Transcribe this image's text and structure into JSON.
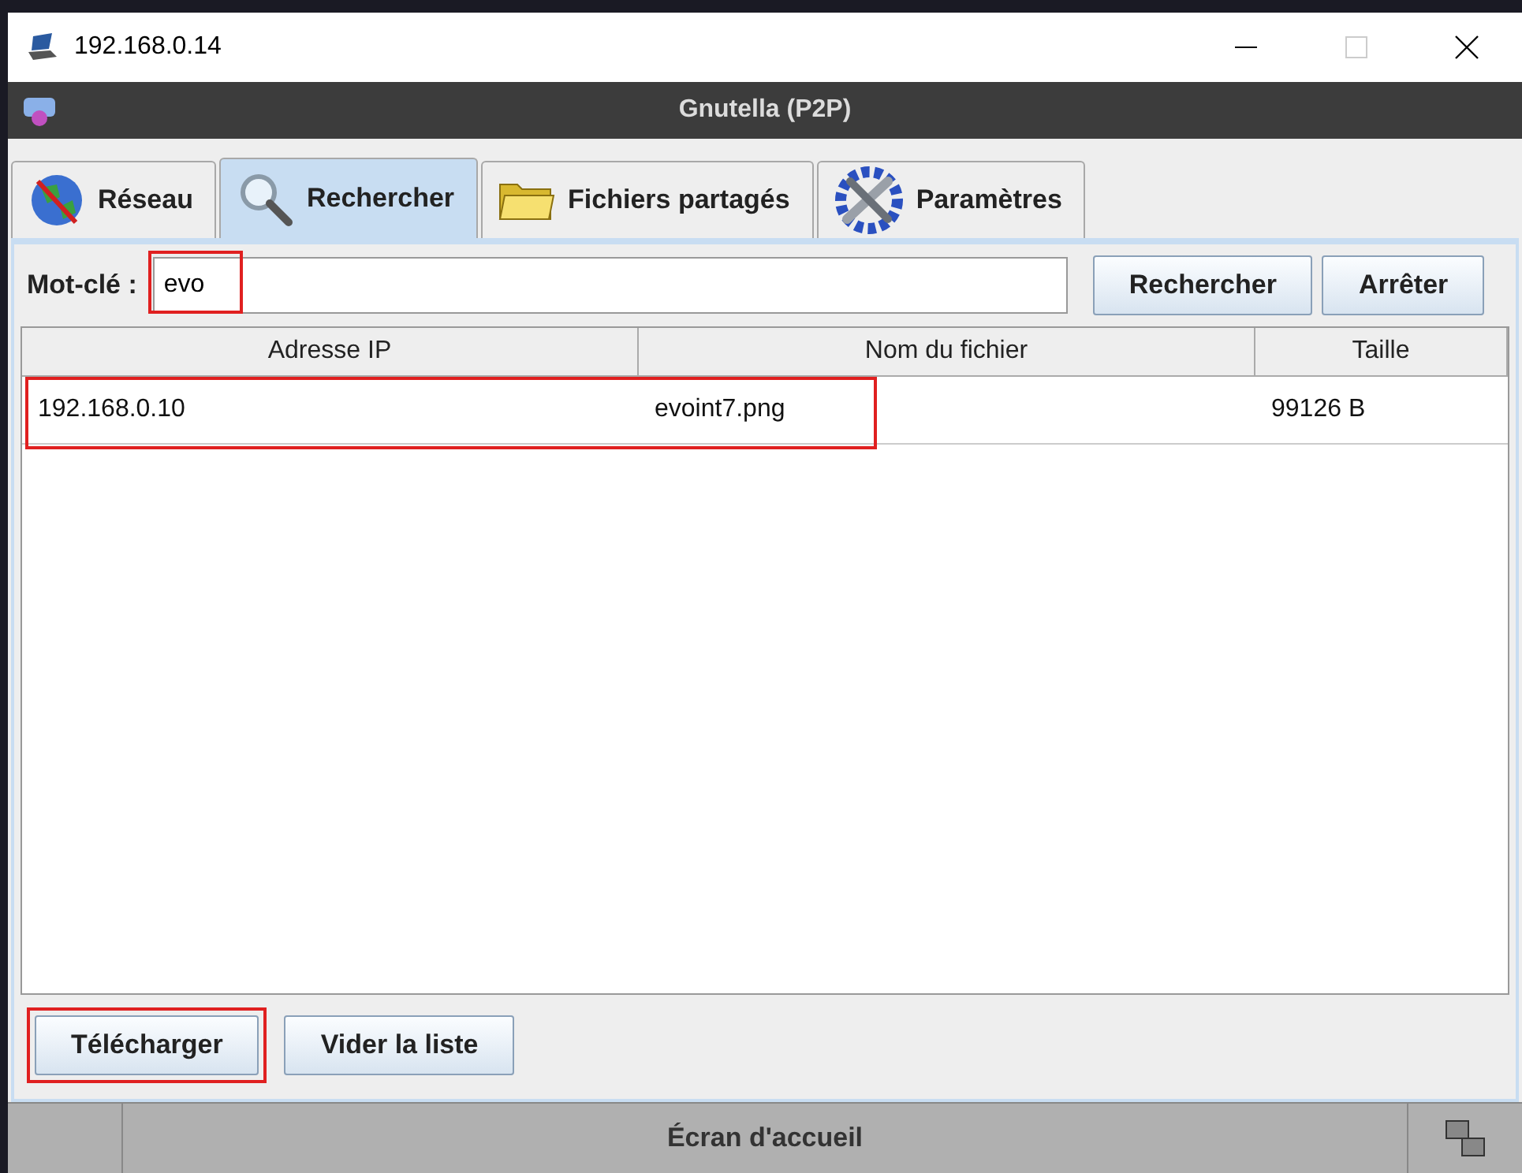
{
  "window": {
    "title": "192.168.0.14"
  },
  "app_title": "Gnutella (P2P)",
  "tabs": [
    {
      "label": "Réseau",
      "selected": false
    },
    {
      "label": "Rechercher",
      "selected": true
    },
    {
      "label": "Fichiers partagés",
      "selected": false
    },
    {
      "label": "Paramètres",
      "selected": false
    }
  ],
  "search": {
    "label": "Mot-clé :",
    "value": "evo",
    "highlighted": true
  },
  "search_buttons": [
    "Rechercher",
    "Arrêter"
  ],
  "table": {
    "columns": [
      "Adresse IP",
      "Nom du fichier",
      "Taille"
    ],
    "rows": [
      {
        "cells": [
          "192.168.0.10",
          "evoint7.png",
          "99126 B"
        ],
        "highlighted": true
      }
    ]
  },
  "buttons": [
    {
      "label": "Télécharger",
      "highlighted": true
    },
    {
      "label": "Vider la liste",
      "highlighted": false
    }
  ],
  "status_bar": {
    "text": "Écran d'accueil"
  }
}
